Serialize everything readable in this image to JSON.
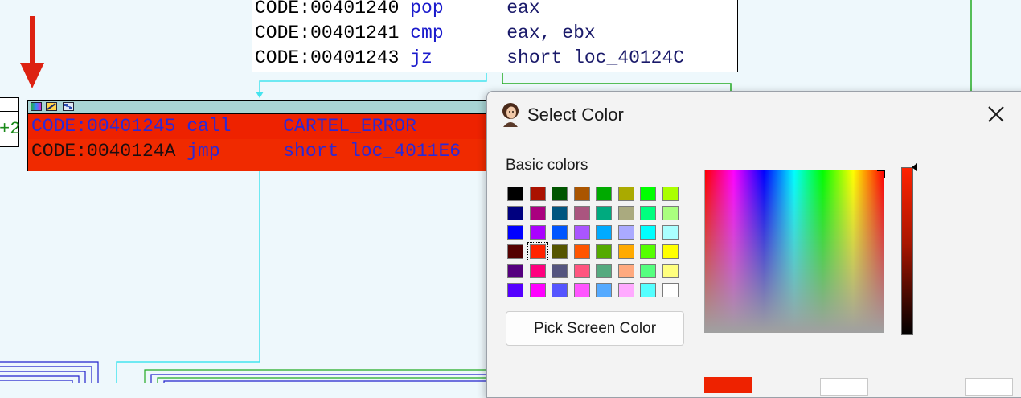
{
  "code_top": {
    "lines": [
      {
        "addr": "CODE:00401240",
        "mnem": "pop",
        "ops": "eax"
      },
      {
        "addr": "CODE:00401241",
        "mnem": "cmp",
        "ops": "eax, ebx"
      },
      {
        "addr": "CODE:00401243",
        "mnem": "jz",
        "ops": "short loc_40124C"
      }
    ]
  },
  "left_node": {
    "text": "+2"
  },
  "red_node": {
    "lines": [
      {
        "addr": "CODE:00401245",
        "mnem": "call",
        "ops": "CARTEL_ERROR"
      },
      {
        "addr": "CODE:0040124A",
        "mnem": "jmp",
        "ops": "short loc_4011E6"
      }
    ]
  },
  "dialog": {
    "title": "Select Color",
    "basic_colors_label": "Basic colors",
    "pick_button_label": "Pick Screen Color",
    "swatches": [
      [
        "#000000",
        "#aa1100",
        "#005500",
        "#aa5500",
        "#00aa00",
        "#aaaa00",
        "#00ff00",
        "#aaff00"
      ],
      [
        "#00007f",
        "#aa007f",
        "#00557f",
        "#aa557f",
        "#00aa7f",
        "#aaaa7f",
        "#00ff7f",
        "#aaff7f"
      ],
      [
        "#0000ff",
        "#aa00ff",
        "#0055ff",
        "#aa55ff",
        "#00aaff",
        "#aaaaff",
        "#00ffff",
        "#aaffff"
      ],
      [
        "#550000",
        "#ff2200",
        "#555500",
        "#ff5500",
        "#55aa00",
        "#ffaa00",
        "#55ff00",
        "#ffff00"
      ],
      [
        "#55007f",
        "#ff007f",
        "#55557f",
        "#ff557f",
        "#55aa7f",
        "#ffaa7f",
        "#55ff7f",
        "#ffff7f"
      ],
      [
        "#5500ff",
        "#ff00ff",
        "#5555ff",
        "#ff55ff",
        "#55aaff",
        "#ffaaff",
        "#55ffff",
        "#ffffff"
      ]
    ],
    "selected_swatch": {
      "row": 3,
      "col": 1
    },
    "current_color": "#ee2200"
  },
  "colors": {
    "graph_bg": "#eef8fc",
    "red_node": "#ee2200",
    "title_bar": "#a8d4d4",
    "arrow": "#dd2211",
    "edge_cyan": "#44e4ee",
    "edge_green": "#22aa22",
    "edge_blue": "#2222cc"
  }
}
